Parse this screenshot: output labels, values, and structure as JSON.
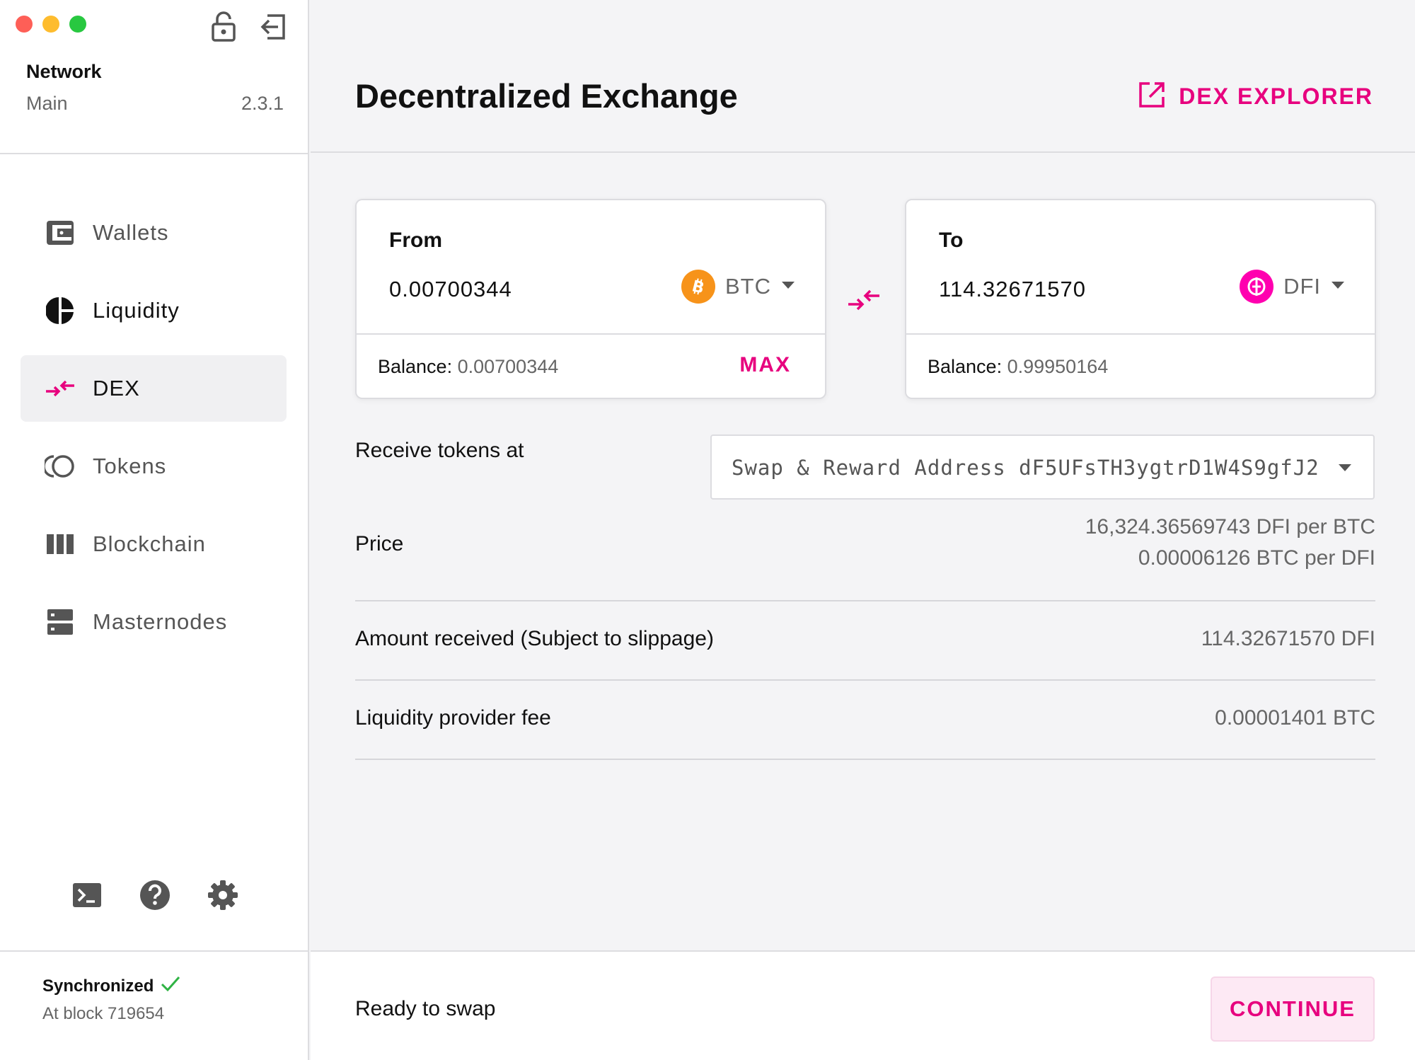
{
  "sidebar": {
    "network_label": "Network",
    "network_name": "Main",
    "version": "2.3.1",
    "items": [
      {
        "label": "Wallets",
        "icon": "wallet-icon"
      },
      {
        "label": "Liquidity",
        "icon": "pie-chart-icon"
      },
      {
        "label": "DEX",
        "icon": "swap-arrows-icon",
        "active": true
      },
      {
        "label": "Tokens",
        "icon": "tokens-icon"
      },
      {
        "label": "Blockchain",
        "icon": "blockchain-icon"
      },
      {
        "label": "Masternodes",
        "icon": "server-icon"
      }
    ],
    "status": {
      "state": "Synchronized",
      "block_text": "At block 719654"
    }
  },
  "header": {
    "title": "Decentralized Exchange",
    "explorer_label": "DEX EXPLORER"
  },
  "from_card": {
    "label": "From",
    "amount": "0.00700344",
    "token": "BTC",
    "balance_label": "Balance",
    "balance_value": "0.00700344",
    "max_label": "MAX"
  },
  "to_card": {
    "label": "To",
    "amount": "114.32671570",
    "token": "DFI",
    "balance_label": "Balance",
    "balance_value": "0.99950164"
  },
  "receive": {
    "label": "Receive tokens at",
    "address_text": "Swap & Reward Address dF5UFsTH3ygtrD1W4S9gfJ2"
  },
  "details": {
    "price_label": "Price",
    "price_line1": "16,324.36569743 DFI per BTC",
    "price_line2": "0.00006126 BTC per DFI",
    "amount_label": "Amount received (Subject to slippage)",
    "amount_value": "114.32671570 DFI",
    "fee_label": "Liquidity provider fee",
    "fee_value": "0.00001401 BTC"
  },
  "footer": {
    "status_text": "Ready to swap",
    "continue_label": "CONTINUE"
  },
  "colors": {
    "accent": "#e7007e",
    "btc": "#f7931a",
    "dfi": "#ff00af",
    "sync": "#2fb344"
  }
}
